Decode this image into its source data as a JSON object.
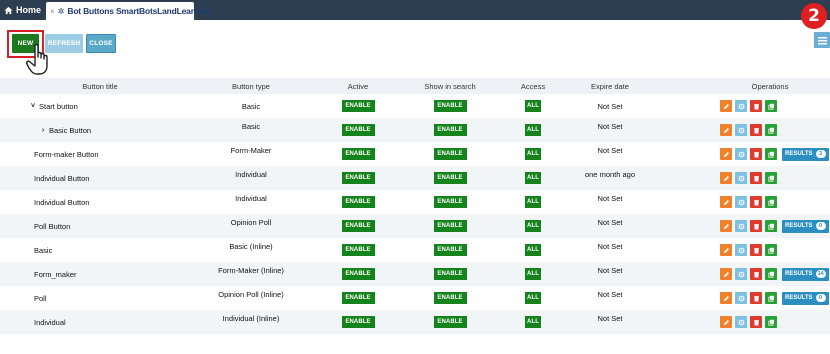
{
  "tabs": {
    "home_label": "Home",
    "active_label": "Bot Buttons SmartBotsLandLearning",
    "active_close": "×"
  },
  "step_badge": "2",
  "toolbar": {
    "new_label": "NEW",
    "refresh_label": "REFRESH",
    "close_label": "CLOSE"
  },
  "table": {
    "headers": {
      "title": "Button title",
      "type": "Button type",
      "active": "Active",
      "search": "Show in search",
      "access": "Access",
      "expire": "Expire date",
      "ops": "Operations"
    },
    "rows": [
      {
        "title": "Start button",
        "expander": "v",
        "type": "Basic",
        "active": "ENABLE",
        "search": "ENABLE",
        "access": "ALL",
        "expire": "Not Set",
        "results": null
      },
      {
        "title": "Basic Button",
        "expander": ">",
        "type": "Basic",
        "active": "ENABLE",
        "search": "ENABLE",
        "access": "ALL",
        "expire": "Not Set",
        "results": null
      },
      {
        "title": "Form-maker Button",
        "expander": "",
        "type": "Form-Maker",
        "active": "ENABLE",
        "search": "ENABLE",
        "access": "ALL",
        "expire": "Not Set",
        "results": {
          "label": "RESULTS",
          "count": "3"
        }
      },
      {
        "title": "Individual Button",
        "expander": "",
        "type": "Individual",
        "active": "ENABLE",
        "search": "ENABLE",
        "access": "ALL",
        "expire": "one month ago",
        "results": null
      },
      {
        "title": "Individual Button",
        "expander": "",
        "type": "Individual",
        "active": "ENABLE",
        "search": "ENABLE",
        "access": "ALL",
        "expire": "Not Set",
        "results": null
      },
      {
        "title": "Poll Button",
        "expander": "",
        "type": "Opinion Poll",
        "active": "ENABLE",
        "search": "ENABLE",
        "access": "ALL",
        "expire": "Not Set",
        "results": {
          "label": "RESULTS",
          "count": "0"
        }
      },
      {
        "title": "Basic",
        "expander": "",
        "type": "Basic (Inline)",
        "active": "ENABLE",
        "search": "ENABLE",
        "access": "ALL",
        "expire": "Not Set",
        "results": null
      },
      {
        "title": "Form_maker",
        "expander": "",
        "type": "Form-Maker (Inline)",
        "active": "ENABLE",
        "search": "ENABLE",
        "access": "ALL",
        "expire": "Not Set",
        "results": {
          "label": "RESULTS",
          "count": "14"
        }
      },
      {
        "title": "Poll",
        "expander": "",
        "type": "Opinion Poll (Inline)",
        "active": "ENABLE",
        "search": "ENABLE",
        "access": "ALL",
        "expire": "Not Set",
        "results": {
          "label": "RESULTS",
          "count": "0"
        }
      },
      {
        "title": "Individual",
        "expander": "",
        "type": "Individual (Inline)",
        "active": "ENABLE",
        "search": "ENABLE",
        "access": "ALL",
        "expire": "Not Set",
        "results": null
      }
    ]
  },
  "colors": {
    "topbar": "#2d3e50",
    "enable_green": "#15831b",
    "edit_orange": "#f0812a",
    "settings_blue": "#7ec0e0",
    "delete_red": "#dd3b2b",
    "copy_green": "#28a036",
    "results_blue": "#2d8ec1",
    "highlight_red": "#d61f26"
  },
  "icons": {
    "home": "home-icon",
    "tab": "bot-icon",
    "list_toggle": "list-icon",
    "pointer": "hand-pointer-icon",
    "edit": "pencil-icon",
    "settings": "gear-icon",
    "delete": "trash-icon",
    "copy": "copy-icon"
  }
}
